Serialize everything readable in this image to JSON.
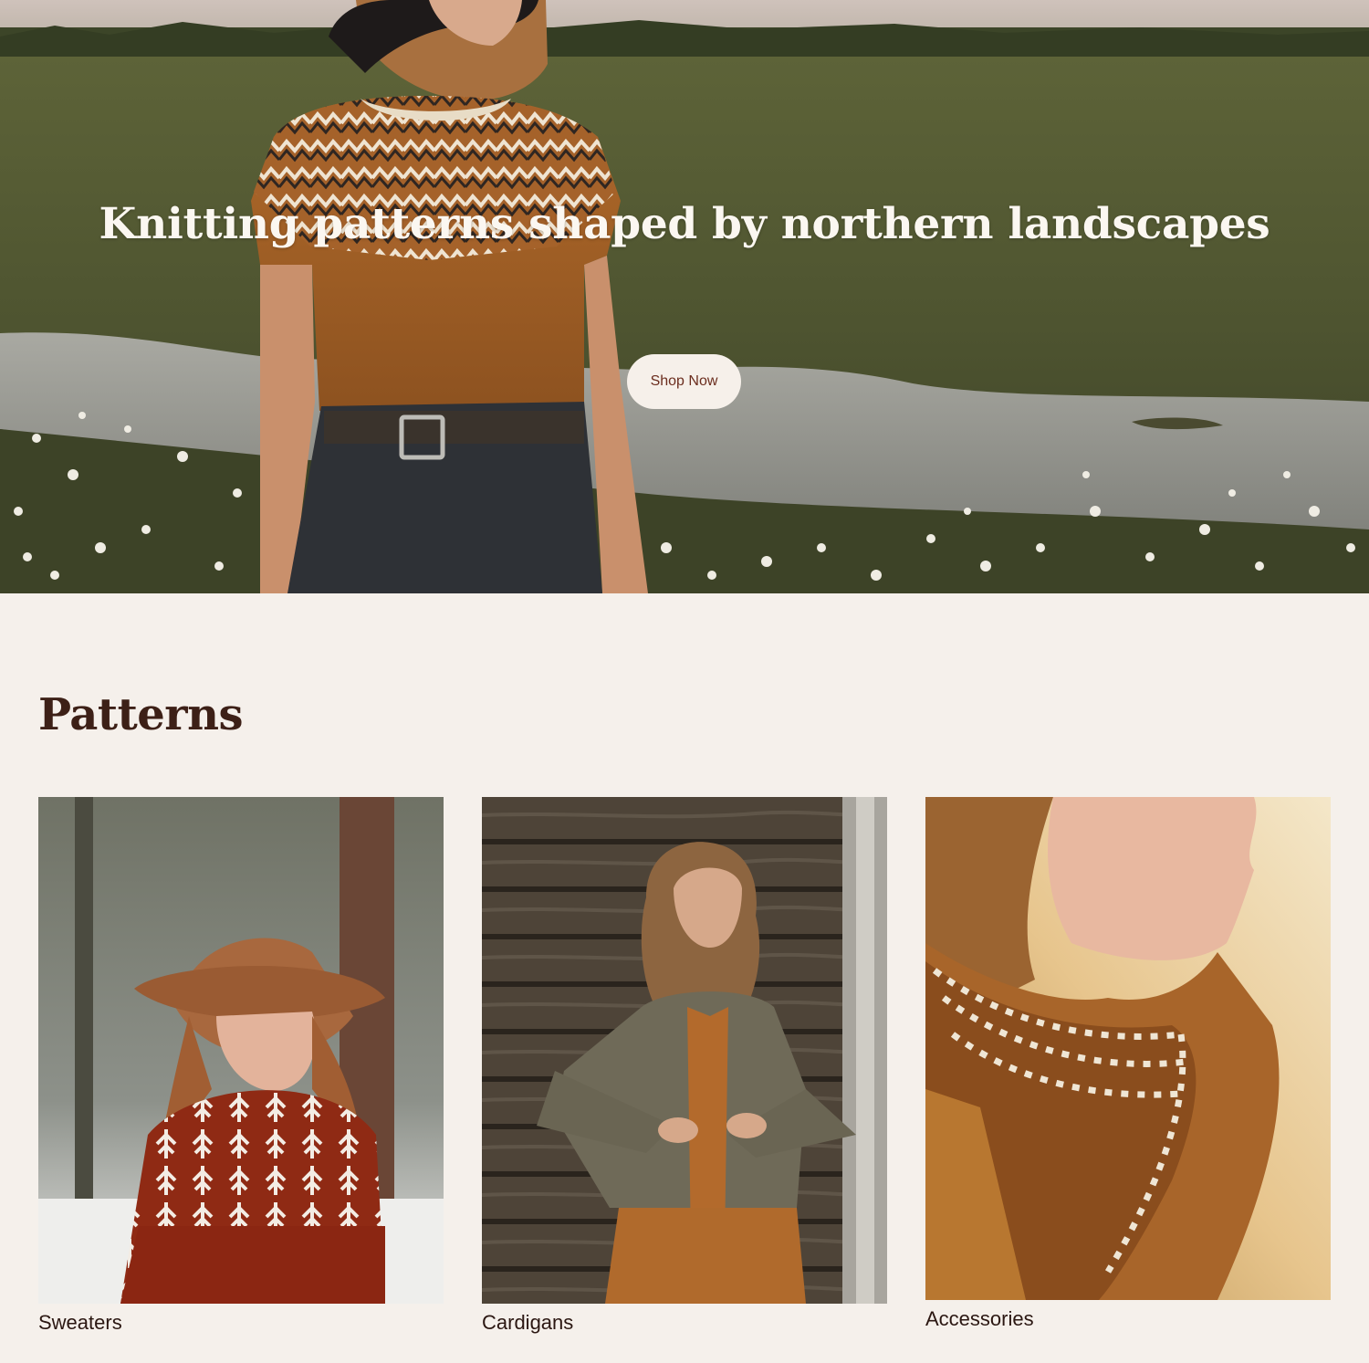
{
  "hero": {
    "title": "Knitting patterns shaped by northern landscapes",
    "cta_label": "Shop Now"
  },
  "patterns": {
    "heading": "Patterns",
    "categories": [
      {
        "label": "Sweaters"
      },
      {
        "label": "Cardigans"
      },
      {
        "label": "Accessories"
      }
    ]
  },
  "colors": {
    "background": "#f5f0eb",
    "heading_text": "#3d2017",
    "button_bg": "#f6f0ea",
    "button_text": "#6b2d1e"
  }
}
